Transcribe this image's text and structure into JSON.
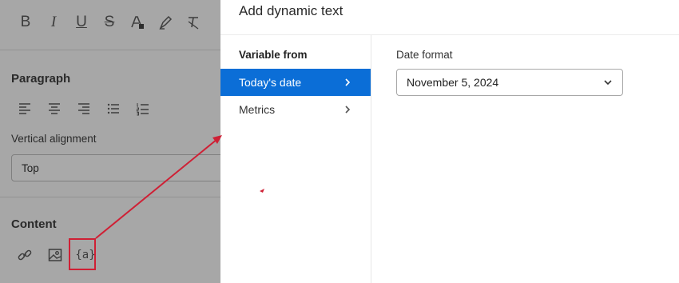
{
  "toolbar": {
    "icons": [
      "bold-icon",
      "italic-icon",
      "underline-icon",
      "strikethrough-icon",
      "text-color-icon",
      "highlight-icon",
      "clear-format-icon"
    ],
    "bold_glyph": "B",
    "italic_glyph": "I",
    "underline_glyph": "U",
    "strike_glyph": "S"
  },
  "paragraph": {
    "title": "Paragraph",
    "icons": [
      "align-left-icon",
      "align-center-icon",
      "align-right-icon",
      "bullet-list-icon",
      "numbered-list-icon"
    ],
    "vertical_alignment_label": "Vertical alignment",
    "vertical_alignment_value": "Top"
  },
  "content": {
    "title": "Content",
    "icons": [
      "link-icon",
      "image-icon",
      "dynamic-text-icon"
    ],
    "dynamic_glyph": "{a}"
  },
  "panel": {
    "title": "Add dynamic text",
    "variable_from_title": "Variable from",
    "items": [
      {
        "label": "Today's date",
        "selected": true
      },
      {
        "label": "Metrics",
        "selected": false
      }
    ],
    "date_format_label": "Date format",
    "date_format_value": "November 5, 2024"
  },
  "colors": {
    "selected": "#0b6ed7",
    "annotation": "#cf2035",
    "overlay_gray": "#a7a7a7"
  }
}
